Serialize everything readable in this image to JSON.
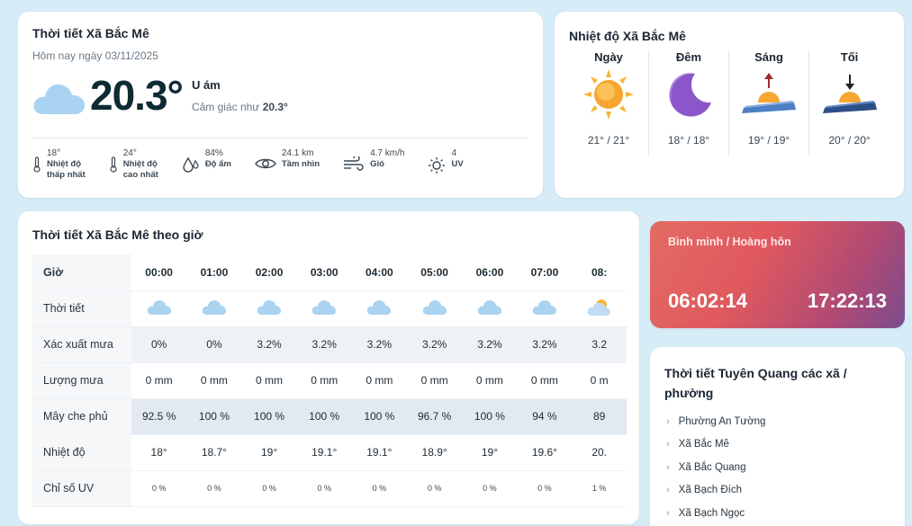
{
  "current": {
    "title": "Thời tiết Xã Bắc Mê",
    "date": "Hôm nay ngày 03/11/2025",
    "temp": "20.3°",
    "condition": "U ám",
    "feels_label": "Cảm giác như",
    "feels_value": "20.3°",
    "icon": "cloud-icon",
    "stats": [
      {
        "icon": "thermometer-icon",
        "value": "18°",
        "label1": "Nhiệt độ",
        "label2": "thấp nhất"
      },
      {
        "icon": "thermometer-icon",
        "value": "24°",
        "label1": "Nhiệt độ",
        "label2": "cao nhất"
      },
      {
        "icon": "humidity-icon",
        "value": "84%",
        "label1": "Độ ẩm",
        "label2": ""
      },
      {
        "icon": "eye-icon",
        "value": "24.1 km",
        "label1": "Tầm nhìn",
        "label2": ""
      },
      {
        "icon": "wind-icon",
        "value": "4.7 km/h",
        "label1": "Gió",
        "label2": ""
      },
      {
        "icon": "sun-icon",
        "value": "4",
        "label1": "UV",
        "label2": ""
      }
    ]
  },
  "temps": {
    "title": "Nhiệt độ Xã Bắc Mê",
    "periods": [
      {
        "label": "Ngày",
        "icon": "sun-icon",
        "range": "21° / 21°"
      },
      {
        "label": "Đêm",
        "icon": "moon-icon",
        "range": "18° / 18°"
      },
      {
        "label": "Sáng",
        "icon": "sunrise-icon",
        "range": "19° / 19°"
      },
      {
        "label": "Tối",
        "icon": "sunset-icon",
        "range": "20° / 20°"
      }
    ]
  },
  "hourly": {
    "title": "Thời tiết Xã Bắc Mê theo giờ",
    "row_labels": {
      "hour": "Giờ",
      "weather": "Thời tiết",
      "rain_chance": "Xác xuất mưa",
      "rain_amount": "Lượng mưa",
      "cloud": "Mây che phủ",
      "temp": "Nhiệt độ",
      "uv": "Chỉ số UV"
    },
    "hours": [
      {
        "time": "00:00",
        "icon": "cloud-icon",
        "rain_chance": "0%",
        "rain_amount": "0 mm",
        "cloud": "92.5 %",
        "temp": "18°",
        "uv": "0 %"
      },
      {
        "time": "01:00",
        "icon": "cloud-icon",
        "rain_chance": "0%",
        "rain_amount": "0 mm",
        "cloud": "100 %",
        "temp": "18.7°",
        "uv": "0 %"
      },
      {
        "time": "02:00",
        "icon": "cloud-icon",
        "rain_chance": "3.2%",
        "rain_amount": "0 mm",
        "cloud": "100 %",
        "temp": "19°",
        "uv": "0 %"
      },
      {
        "time": "03:00",
        "icon": "cloud-icon",
        "rain_chance": "3.2%",
        "rain_amount": "0 mm",
        "cloud": "100 %",
        "temp": "19.1°",
        "uv": "0 %"
      },
      {
        "time": "04:00",
        "icon": "cloud-icon",
        "rain_chance": "3.2%",
        "rain_amount": "0 mm",
        "cloud": "100 %",
        "temp": "19.1°",
        "uv": "0 %"
      },
      {
        "time": "05:00",
        "icon": "cloud-icon",
        "rain_chance": "3.2%",
        "rain_amount": "0 mm",
        "cloud": "96.7 %",
        "temp": "18.9°",
        "uv": "0 %"
      },
      {
        "time": "06:00",
        "icon": "cloud-icon",
        "rain_chance": "3.2%",
        "rain_amount": "0 mm",
        "cloud": "100 %",
        "temp": "19°",
        "uv": "0 %"
      },
      {
        "time": "07:00",
        "icon": "cloud-icon",
        "rain_chance": "3.2%",
        "rain_amount": "0 mm",
        "cloud": "94 %",
        "temp": "19.6°",
        "uv": "0 %"
      },
      {
        "time": "08:",
        "icon": "partly-cloudy-icon",
        "rain_chance": "3.2",
        "rain_amount": "0 m",
        "cloud": "89",
        "temp": "20.",
        "uv": "1 %"
      }
    ]
  },
  "sun": {
    "title": "Bình minh / Hoàng hôn",
    "sunrise": "06:02:14",
    "sunset": "17:22:13"
  },
  "communes": {
    "title": "Thời tiết Tuyên Quang các xã / phường",
    "items": [
      "Phường An Tường",
      "Xã Bắc Mê",
      "Xã Bắc Quang",
      "Xã Bạch Đích",
      "Xã Bạch Ngọc"
    ]
  }
}
